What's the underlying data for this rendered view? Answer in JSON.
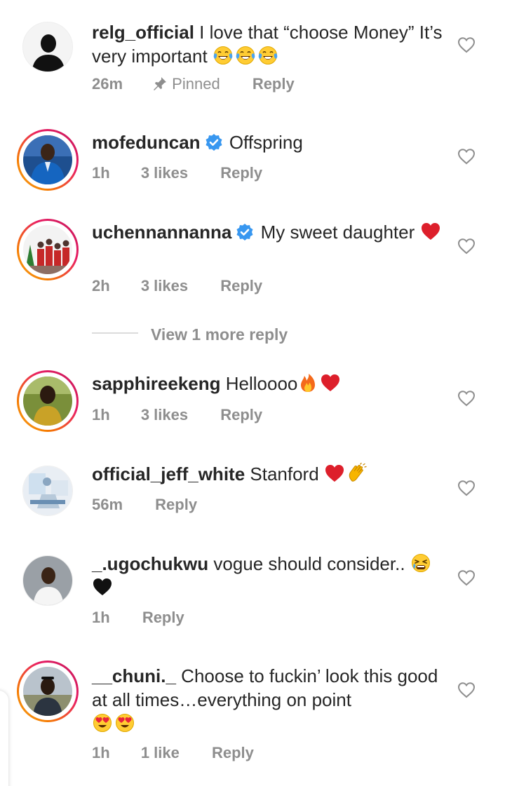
{
  "comments": [
    {
      "username": "relg_official",
      "verified": false,
      "text": "I love that “choose Money” It’s very important",
      "emojis": [
        "tears-of-joy",
        "tears-of-joy",
        "tears-of-joy"
      ],
      "time": "26m",
      "likes": "",
      "pinned_label": "Pinned",
      "reply_label": "Reply",
      "avatar_icon": "avatar-silhouette"
    },
    {
      "username": "mofeduncan",
      "verified": true,
      "text": "Offspring",
      "emojis": [],
      "time": "1h",
      "likes": "3 likes",
      "reply_label": "Reply",
      "avatar_icon": "avatar-man-blue-suit"
    },
    {
      "username": "uchennannanna",
      "verified": true,
      "text": "My sweet daughter",
      "emojis": [
        "red-heart"
      ],
      "time": "2h",
      "likes": "3 likes",
      "reply_label": "Reply",
      "avatar_icon": "avatar-family-christmas"
    },
    {
      "username": "sapphireekeng",
      "verified": false,
      "text": "Helloooo",
      "emojis": [
        "fire",
        "red-heart"
      ],
      "time": "1h",
      "likes": "3 likes",
      "reply_label": "Reply",
      "avatar_icon": "avatar-woman-outdoors"
    },
    {
      "username": "official_jeff_white",
      "verified": false,
      "text": "Stanford",
      "emojis": [
        "red-heart",
        "clapping-hands"
      ],
      "time": "56m",
      "likes": "",
      "reply_label": "Reply",
      "avatar_icon": "avatar-room-light"
    },
    {
      "username": "_.ugochukwu",
      "verified": false,
      "text": "vogue should consider..",
      "emojis": [
        "tired-face",
        "black-heart"
      ],
      "time": "1h",
      "likes": "",
      "reply_label": "Reply",
      "avatar_icon": "avatar-man-white-top"
    },
    {
      "username": "__chuni._",
      "verified": false,
      "text": "Choose to fuckin’ look this good at all times…everything on point",
      "emojis": [
        "heart-eyes",
        "heart-eyes"
      ],
      "time": "1h",
      "likes": "1 like",
      "reply_label": "Reply",
      "avatar_icon": "avatar-man-sunglasses"
    }
  ],
  "view_more_replies": "View 1 more reply",
  "colors": {
    "text_primary": "#262626",
    "text_secondary": "#8e8e8e",
    "verified_blue": "#3897f0",
    "story_ring_start": "#f9a825",
    "story_ring_end": "#c2185b"
  }
}
